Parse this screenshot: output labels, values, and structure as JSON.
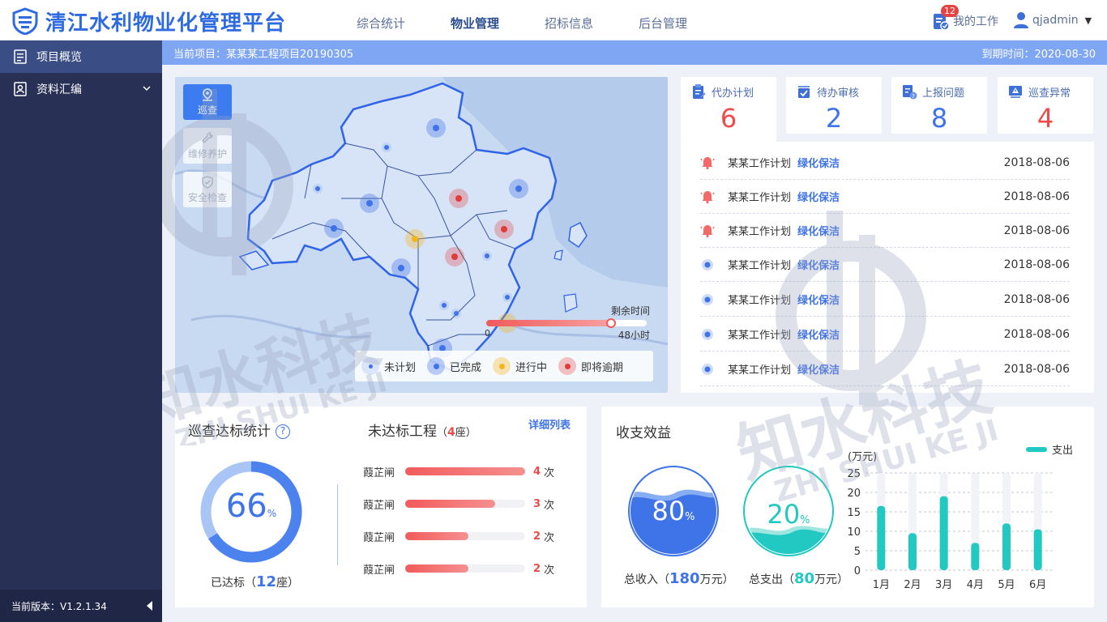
{
  "header": {
    "title": "清江水利物业化管理平台",
    "nav": [
      "综合统计",
      "物业管理",
      "招标信息",
      "后台管理"
    ],
    "active_nav": "物业管理",
    "my_work_label": "我的工作",
    "my_work_badge": "12",
    "username": "qjadmin"
  },
  "sidebar": {
    "items": [
      {
        "label": "项目概览",
        "icon": "overview-icon",
        "active": true
      },
      {
        "label": "资料汇编",
        "icon": "document-icon",
        "active": false
      }
    ],
    "version": "当前版本：V1.2.1.34"
  },
  "project_bar": {
    "current_project": "当前项目：某某某工程项目20190305",
    "expire": "到期时间：2020-08-30"
  },
  "map": {
    "tools": [
      {
        "label": "巡查",
        "icon": "location-pin-icon",
        "active": true
      },
      {
        "label": "维修养护",
        "icon": "wrench-icon",
        "active": false
      },
      {
        "label": "安全检查",
        "icon": "shield-icon",
        "active": false
      }
    ],
    "time": {
      "label": "剩余时间",
      "start": "0",
      "end": "48小时",
      "progress": 0.78
    },
    "legend": [
      {
        "label": "未计划",
        "color": "#3f73e8",
        "halo": "rgba(63,115,232,0.15)"
      },
      {
        "label": "已完成",
        "color": "#3f73e8",
        "halo": "rgba(63,115,232,0.35)"
      },
      {
        "label": "进行中",
        "color": "#f3b51f",
        "halo": "rgba(243,181,31,0.35)"
      },
      {
        "label": "即将逾期",
        "color": "#e03c3c",
        "halo": "rgba(224,60,60,0.3)"
      }
    ]
  },
  "stats": [
    {
      "label": "代办计划",
      "value": "6",
      "color": "red",
      "icon": "plan-icon"
    },
    {
      "label": "待办审核",
      "value": "2",
      "color": "blue",
      "icon": "review-icon"
    },
    {
      "label": "上报问题",
      "value": "8",
      "color": "blue",
      "icon": "question-icon"
    },
    {
      "label": "巡查异常",
      "value": "4",
      "color": "red",
      "icon": "warning-icon"
    }
  ],
  "tasks": [
    {
      "name": "某某工作计划",
      "tag": "绿化保洁",
      "date": "2018-08-06",
      "status": "alarm"
    },
    {
      "name": "某某工作计划",
      "tag": "绿化保洁",
      "date": "2018-08-06",
      "status": "alarm"
    },
    {
      "name": "某某工作计划",
      "tag": "绿化保洁",
      "date": "2018-08-06",
      "status": "alarm"
    },
    {
      "name": "某某工作计划",
      "tag": "绿化保洁",
      "date": "2018-08-06",
      "status": "normal"
    },
    {
      "name": "某某工作计划",
      "tag": "绿化保洁",
      "date": "2018-08-06",
      "status": "normal"
    },
    {
      "name": "某某工作计划",
      "tag": "绿化保洁",
      "date": "2018-08-06",
      "status": "normal"
    },
    {
      "name": "某某工作计划",
      "tag": "绿化保洁",
      "date": "2018-08-06",
      "status": "normal"
    }
  ],
  "patrol": {
    "title": "巡查达标统计",
    "percent": "66",
    "percent_unit": "%",
    "percent_value": 0.66,
    "reached_prefix": "已达标（",
    "reached_count": "12",
    "reached_suffix": "座）",
    "unreached_title": "未达标工程",
    "unreached_prefix": "（",
    "unreached_count": "4",
    "unreached_suffix": "座）",
    "detail_link": "详细列表",
    "bars": [
      {
        "name": "葭芷闸",
        "count": "4",
        "unit": "次",
        "ratio": 1.0
      },
      {
        "name": "葭芷闸",
        "count": "3",
        "unit": "次",
        "ratio": 0.75
      },
      {
        "name": "葭芷闸",
        "count": "2",
        "unit": "次",
        "ratio": 0.53
      },
      {
        "name": "葭芷闸",
        "count": "2",
        "unit": "次",
        "ratio": 0.53
      }
    ]
  },
  "finance": {
    "title": "收支效益",
    "income": {
      "percent": "80",
      "unit": "%",
      "label_prefix": "总收入（",
      "amount": "180",
      "label_suffix": "万元）"
    },
    "expense": {
      "percent": "20",
      "unit": "%",
      "label_prefix": "总支出（",
      "amount": "80",
      "label_suffix": "万元）"
    }
  },
  "chart_data": {
    "type": "bar",
    "ylabel": "(万元)",
    "legend": "支出",
    "ylim": [
      0,
      25
    ],
    "yticks": [
      "25",
      "20",
      "15",
      "10",
      "5",
      "0"
    ],
    "categories": [
      "1月",
      "2月",
      "3月",
      "4月",
      "5月",
      "6月"
    ],
    "series": [
      {
        "name": "支出",
        "values": [
          16.5,
          9.5,
          19,
          7,
          12,
          10.5
        ]
      }
    ]
  },
  "watermark": {
    "text": "知水科技",
    "pinyin": "ZHI SHUI KE JI"
  }
}
